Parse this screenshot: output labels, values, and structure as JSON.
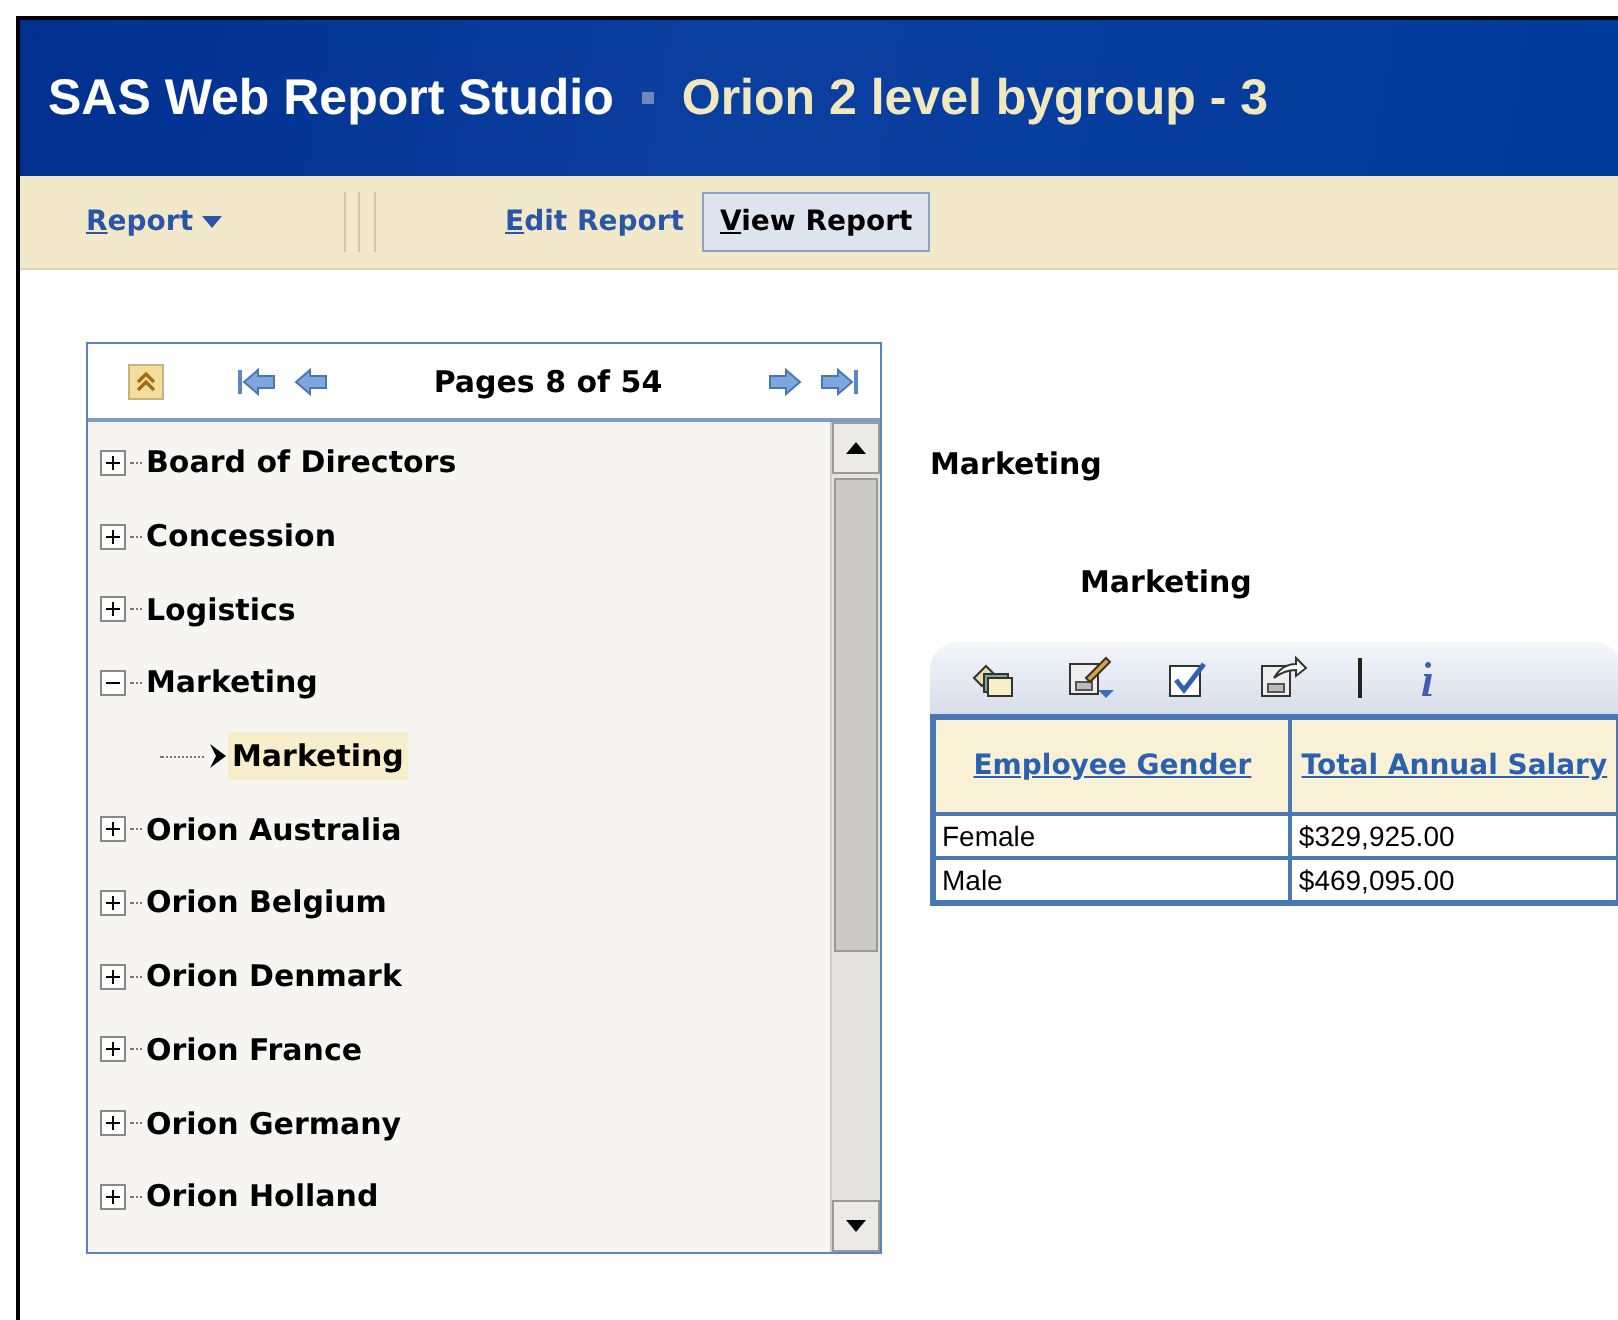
{
  "app_title": "SAS Web Report Studio",
  "report_title": "Orion 2 level bygroup - 3",
  "menu": [
    {
      "label": "Report",
      "kind": "dropdown",
      "selected": false
    },
    {
      "label": "Edit Report",
      "kind": "link",
      "selected": false
    },
    {
      "label": "View Report",
      "kind": "link",
      "selected": true
    }
  ],
  "pager": {
    "label": "Pages 8 of 54"
  },
  "tree": [
    {
      "label": "Board of Directors",
      "expanded": false,
      "selected": false
    },
    {
      "label": "Concession",
      "expanded": false,
      "selected": false
    },
    {
      "label": "Logistics",
      "expanded": false,
      "selected": false
    },
    {
      "label": "Marketing",
      "expanded": true,
      "selected": false,
      "children": [
        {
          "label": "Marketing",
          "selected": true
        }
      ]
    },
    {
      "label": "Orion Australia",
      "expanded": false,
      "selected": false
    },
    {
      "label": "Orion Belgium",
      "expanded": false,
      "selected": false
    },
    {
      "label": "Orion Denmark",
      "expanded": false,
      "selected": false
    },
    {
      "label": "Orion France",
      "expanded": false,
      "selected": false
    },
    {
      "label": "Orion Germany",
      "expanded": false,
      "selected": false
    },
    {
      "label": "Orion Holland",
      "expanded": false,
      "selected": false
    }
  ],
  "report": {
    "group_heading": "Marketing",
    "table_title": "Marketing",
    "table": {
      "columns": [
        "Employee Gender",
        "Total Annual Salary"
      ],
      "rows": [
        [
          "Female",
          "$329,925.00"
        ],
        [
          "Male",
          "$469,095.00"
        ]
      ]
    }
  }
}
